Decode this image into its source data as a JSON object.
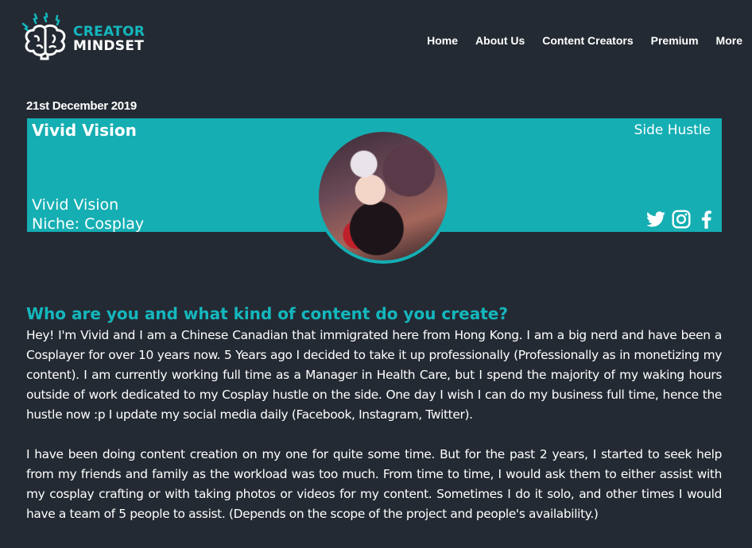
{
  "header": {
    "logo": {
      "line1": "CREATOR",
      "line2": "MINDSET",
      "icon": "brain-icon"
    },
    "nav": [
      "Home",
      "About Us",
      "Content Creators",
      "Premium",
      "More"
    ]
  },
  "post": {
    "date": "21st December 2019",
    "banner": {
      "title": "Vivid Vision",
      "category": "Side Hustle",
      "name": "Vivid Vision",
      "niche": "Niche: Cosplay",
      "social": [
        "twitter-icon",
        "instagram-icon",
        "facebook-icon"
      ]
    },
    "question": "Who are you and what kind of content do you create?",
    "paragraphs": [
      "Hey! I'm Vivid and I am a Chinese Canadian that immigrated here from Hong Kong. I am a big nerd and have been a Cosplayer for over 10 years now. 5 Years ago I decided to take it up professionally (Professionally as in monetizing my content). I am currently working full time as a Manager in Health Care, but I spend the majority of my waking hours outside of work dedicated to my Cosplay hustle on the side. One day I wish I can do my business full time, hence the hustle now :p I update my social media daily (Facebook, Instagram, Twitter).",
      "I have been doing content creation on my one for quite some time. But for the past 2 years, I started to seek help from my friends and family as the workload was too much. From time to time, I would ask them to either assist with my cosplay crafting or with taking photos or videos for my content. Sometimes I do it solo, and other times I would have a team of 5 people to assist. (Depends on the scope of the project and people's availability.)"
    ]
  },
  "colors": {
    "background": "#242a33",
    "accent": "#14aeb3"
  }
}
